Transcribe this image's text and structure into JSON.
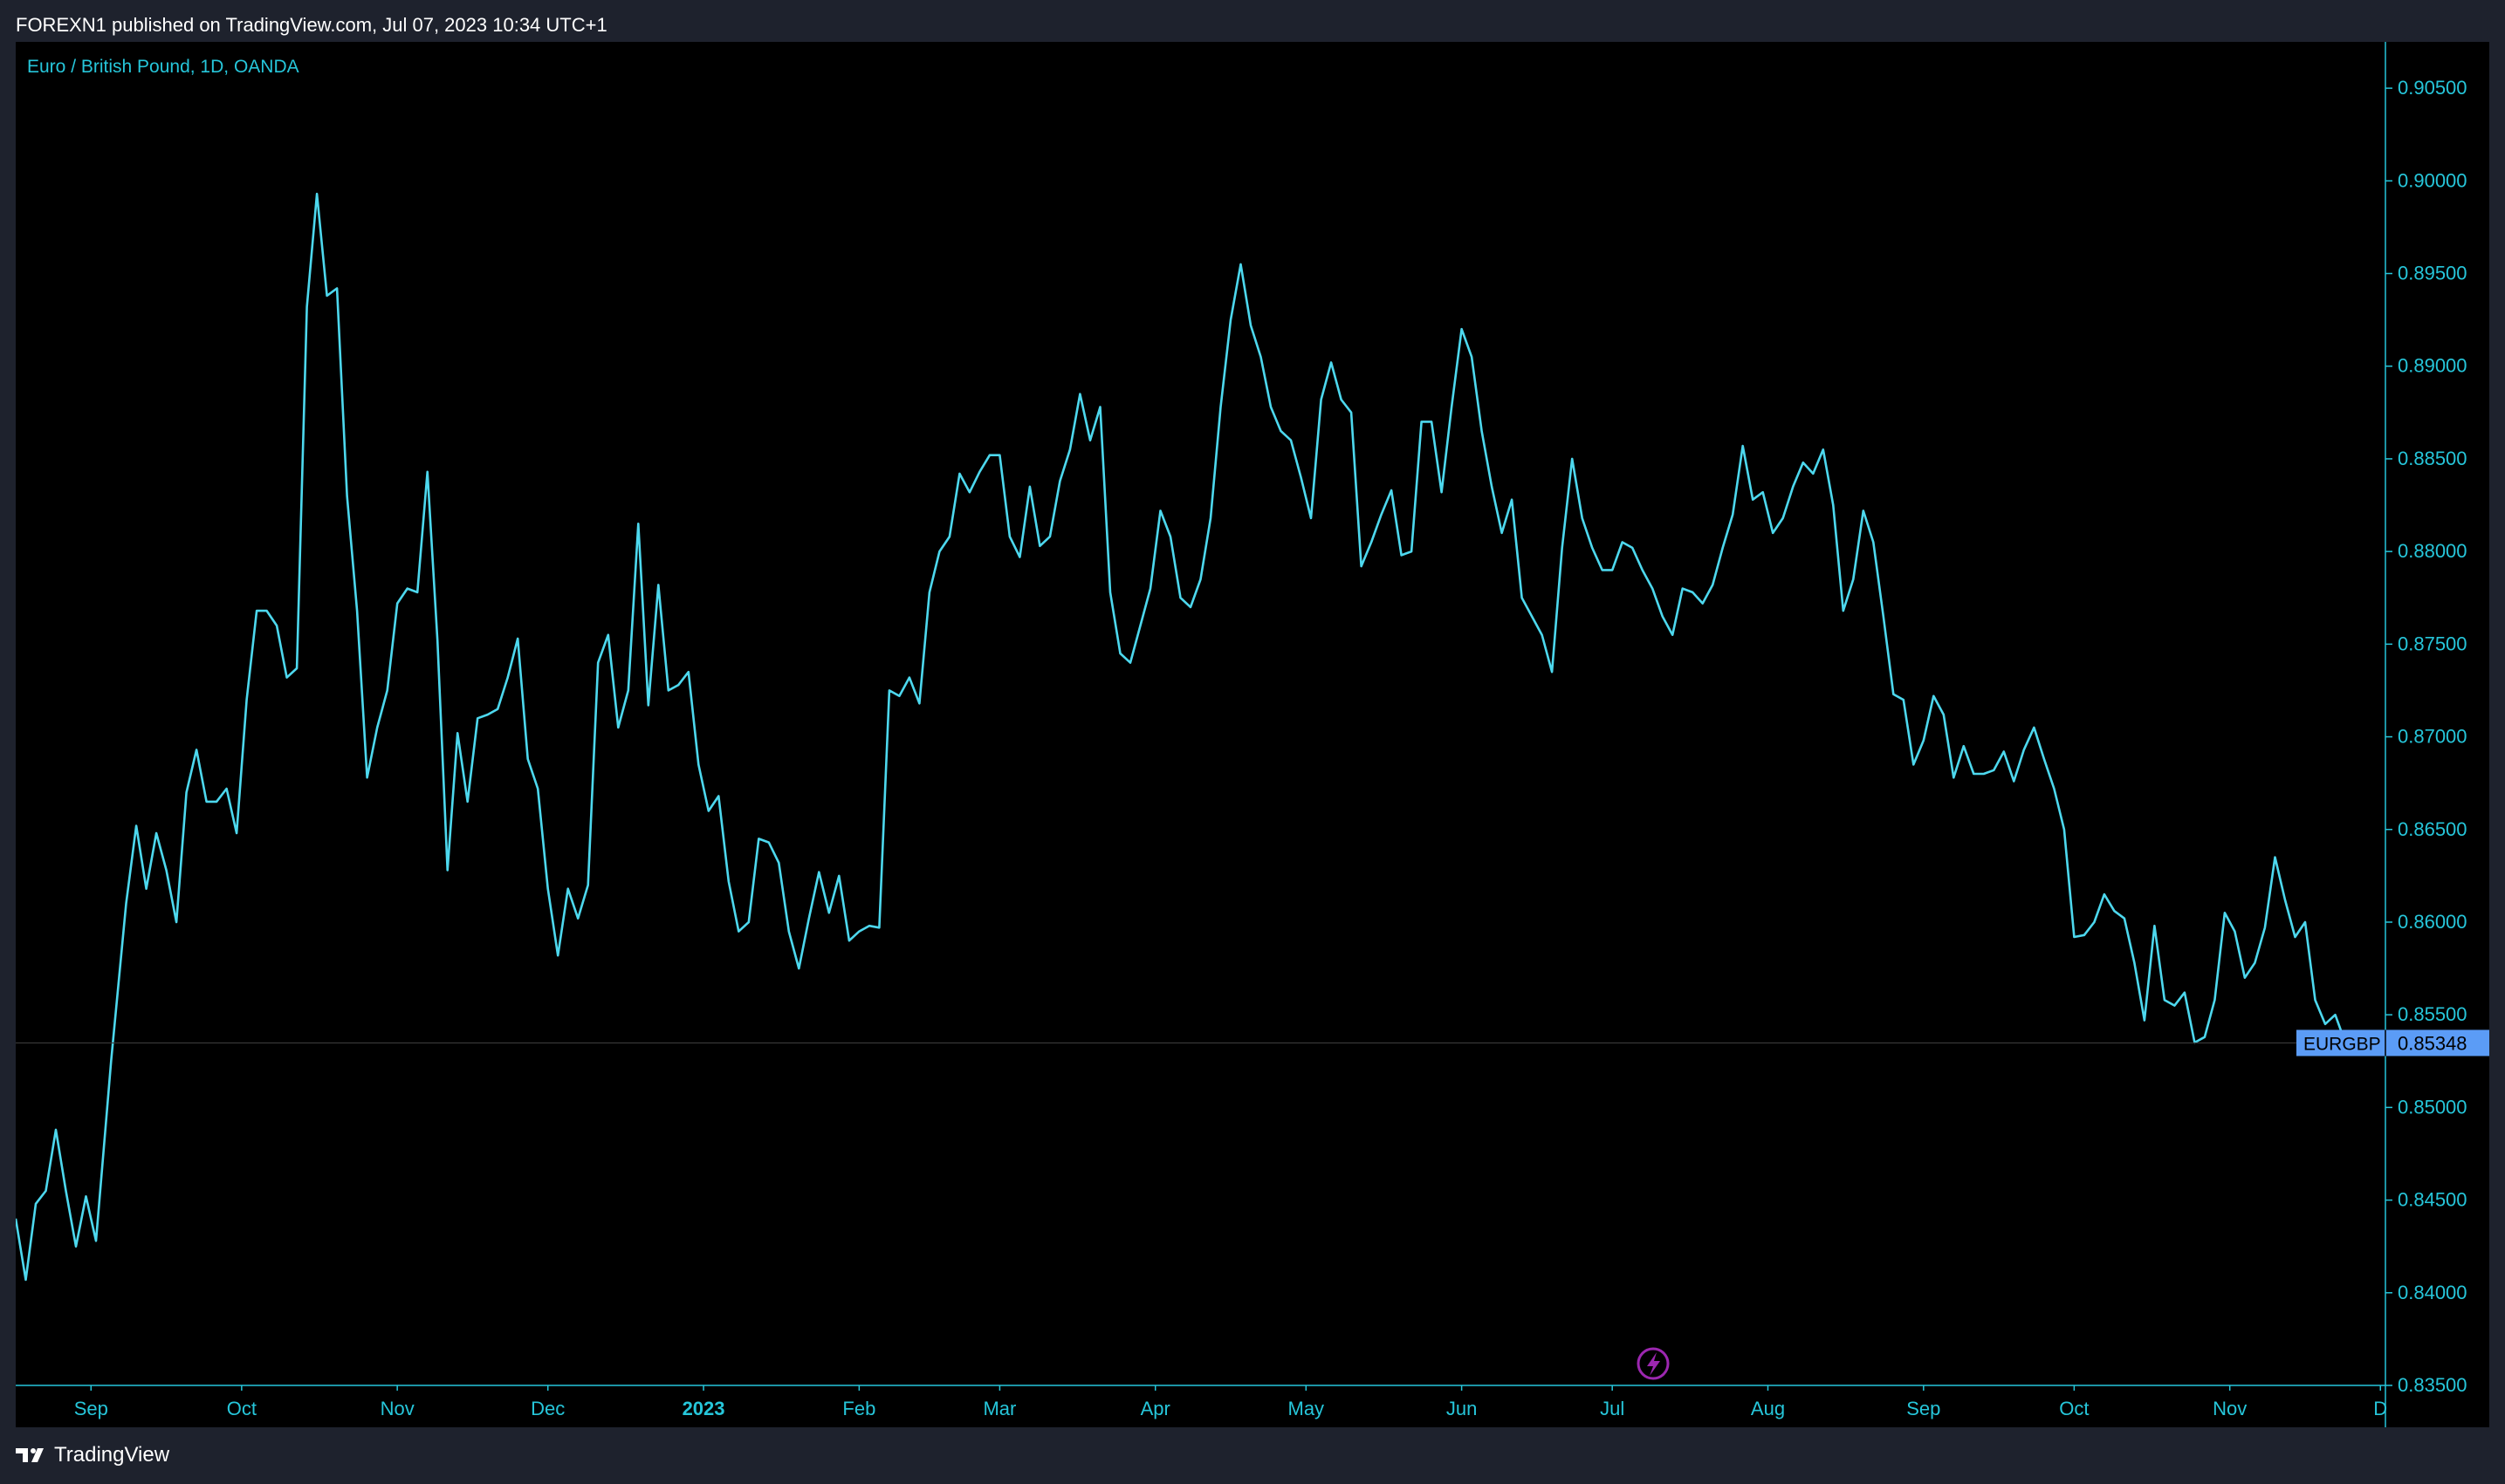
{
  "header": {
    "published_text": "FOREXN1 published on TradingView.com, Jul 07, 2023 10:34 UTC+1"
  },
  "footer": {
    "brand": "TradingView",
    "logo_icon": "tradingview-logo-icon"
  },
  "colors": {
    "line": "#4dd8ee",
    "axis_text": "#26c6da",
    "badge_bg": "#5b9cf6",
    "badge_text": "#000000",
    "lightning_icon": "#9c27b0",
    "panel_bg": "#000000",
    "frame_bg": "#1e222d"
  },
  "chart_data": {
    "type": "line",
    "title": "Euro / British Pound, 1D, OANDA",
    "xlabel": "",
    "ylabel": "",
    "grid": false,
    "ylim": [
      0.835,
      0.9075
    ],
    "xlim": [
      "2022-08-17",
      "2023-12-02"
    ],
    "y_ticks": [
      "0.90500",
      "0.90000",
      "0.89500",
      "0.89000",
      "0.88500",
      "0.88000",
      "0.87500",
      "0.87000",
      "0.86500",
      "0.86000",
      "0.85500",
      "0.85000",
      "0.84500",
      "0.84000",
      "0.83500"
    ],
    "x_ticks": [
      {
        "label": "Sep",
        "date": "2022-09-01",
        "bold": false
      },
      {
        "label": "Oct",
        "date": "2022-10-01",
        "bold": false
      },
      {
        "label": "Nov",
        "date": "2022-11-01",
        "bold": false
      },
      {
        "label": "Dec",
        "date": "2022-12-01",
        "bold": false
      },
      {
        "label": "2023",
        "date": "2023-01-01",
        "bold": true
      },
      {
        "label": "Feb",
        "date": "2023-02-01",
        "bold": false
      },
      {
        "label": "Mar",
        "date": "2023-03-01",
        "bold": false
      },
      {
        "label": "Apr",
        "date": "2023-04-01",
        "bold": false
      },
      {
        "label": "May",
        "date": "2023-05-01",
        "bold": false
      },
      {
        "label": "Jun",
        "date": "2023-06-01",
        "bold": false
      },
      {
        "label": "Jul",
        "date": "2023-07-01",
        "bold": false
      },
      {
        "label": "Aug",
        "date": "2023-08-01",
        "bold": false
      },
      {
        "label": "Sep",
        "date": "2023-09-01",
        "bold": false
      },
      {
        "label": "Oct",
        "date": "2023-10-01",
        "bold": false
      },
      {
        "label": "Nov",
        "date": "2023-11-01",
        "bold": false
      },
      {
        "label": "D",
        "date": "2023-12-01",
        "bold": false
      }
    ],
    "last_price": {
      "symbol": "EURGBP",
      "value": "0.85348"
    },
    "series": [
      {
        "points": [
          [
            "2022-08-17",
            0.844
          ],
          [
            "2022-08-19",
            0.8407
          ],
          [
            "2022-08-21",
            0.8448
          ],
          [
            "2022-08-23",
            0.8455
          ],
          [
            "2022-08-25",
            0.8488
          ],
          [
            "2022-08-27",
            0.8455
          ],
          [
            "2022-08-29",
            0.8425
          ],
          [
            "2022-08-31",
            0.8452
          ],
          [
            "2022-09-02",
            0.8428
          ],
          [
            "2022-09-05",
            0.8525
          ],
          [
            "2022-09-08",
            0.861
          ],
          [
            "2022-09-10",
            0.8652
          ],
          [
            "2022-09-12",
            0.8618
          ],
          [
            "2022-09-14",
            0.8648
          ],
          [
            "2022-09-16",
            0.8628
          ],
          [
            "2022-09-18",
            0.86
          ],
          [
            "2022-09-20",
            0.867
          ],
          [
            "2022-09-22",
            0.8693
          ],
          [
            "2022-09-24",
            0.8665
          ],
          [
            "2022-09-26",
            0.8665
          ],
          [
            "2022-09-28",
            0.8672
          ],
          [
            "2022-09-30",
            0.8648
          ],
          [
            "2022-10-02",
            0.872
          ],
          [
            "2022-10-04",
            0.8768
          ],
          [
            "2022-10-06",
            0.8768
          ],
          [
            "2022-10-08",
            0.876
          ],
          [
            "2022-10-10",
            0.8732
          ],
          [
            "2022-10-12",
            0.8737
          ],
          [
            "2022-10-14",
            0.8932
          ],
          [
            "2022-10-16",
            0.8993
          ],
          [
            "2022-10-18",
            0.8938
          ],
          [
            "2022-10-20",
            0.8942
          ],
          [
            "2022-10-22",
            0.883
          ],
          [
            "2022-10-24",
            0.8768
          ],
          [
            "2022-10-26",
            0.8678
          ],
          [
            "2022-10-28",
            0.8705
          ],
          [
            "2022-10-30",
            0.8725
          ],
          [
            "2022-11-01",
            0.8772
          ],
          [
            "2022-11-03",
            0.878
          ],
          [
            "2022-11-05",
            0.8778
          ],
          [
            "2022-11-07",
            0.8843
          ],
          [
            "2022-11-09",
            0.8752
          ],
          [
            "2022-11-11",
            0.8628
          ],
          [
            "2022-11-13",
            0.8702
          ],
          [
            "2022-11-15",
            0.8665
          ],
          [
            "2022-11-17",
            0.871
          ],
          [
            "2022-11-19",
            0.8712
          ],
          [
            "2022-11-21",
            0.8715
          ],
          [
            "2022-11-23",
            0.8732
          ],
          [
            "2022-11-25",
            0.8753
          ],
          [
            "2022-11-27",
            0.8688
          ],
          [
            "2022-11-29",
            0.8672
          ],
          [
            "2022-12-01",
            0.8618
          ],
          [
            "2022-12-03",
            0.8582
          ],
          [
            "2022-12-05",
            0.8618
          ],
          [
            "2022-12-07",
            0.8602
          ],
          [
            "2022-12-09",
            0.862
          ],
          [
            "2022-12-11",
            0.874
          ],
          [
            "2022-12-13",
            0.8755
          ],
          [
            "2022-12-15",
            0.8705
          ],
          [
            "2022-12-17",
            0.8725
          ],
          [
            "2022-12-19",
            0.8815
          ],
          [
            "2022-12-21",
            0.8717
          ],
          [
            "2022-12-23",
            0.8782
          ],
          [
            "2022-12-25",
            0.8725
          ],
          [
            "2022-12-27",
            0.8728
          ],
          [
            "2022-12-29",
            0.8735
          ],
          [
            "2022-12-31",
            0.8685
          ],
          [
            "2023-01-02",
            0.866
          ],
          [
            "2023-01-04",
            0.8668
          ],
          [
            "2023-01-06",
            0.8622
          ],
          [
            "2023-01-08",
            0.8595
          ],
          [
            "2023-01-10",
            0.86
          ],
          [
            "2023-01-12",
            0.8645
          ],
          [
            "2023-01-14",
            0.8643
          ],
          [
            "2023-01-16",
            0.8632
          ],
          [
            "2023-01-18",
            0.8595
          ],
          [
            "2023-01-20",
            0.8575
          ],
          [
            "2023-01-22",
            0.8602
          ],
          [
            "2023-01-24",
            0.8627
          ],
          [
            "2023-01-26",
            0.8605
          ],
          [
            "2023-01-28",
            0.8625
          ],
          [
            "2023-01-30",
            0.859
          ],
          [
            "2023-02-01",
            0.8595
          ],
          [
            "2023-02-03",
            0.8598
          ],
          [
            "2023-02-05",
            0.8597
          ],
          [
            "2023-02-07",
            0.8725
          ],
          [
            "2023-02-09",
            0.8722
          ],
          [
            "2023-02-11",
            0.8732
          ],
          [
            "2023-02-13",
            0.8718
          ],
          [
            "2023-02-15",
            0.8778
          ],
          [
            "2023-02-17",
            0.88
          ],
          [
            "2023-02-19",
            0.8808
          ],
          [
            "2023-02-21",
            0.8842
          ],
          [
            "2023-02-23",
            0.8832
          ],
          [
            "2023-02-25",
            0.8843
          ],
          [
            "2023-02-27",
            0.8852
          ],
          [
            "2023-03-01",
            0.8852
          ],
          [
            "2023-03-03",
            0.8808
          ],
          [
            "2023-03-05",
            0.8797
          ],
          [
            "2023-03-07",
            0.8835
          ],
          [
            "2023-03-09",
            0.8803
          ],
          [
            "2023-03-11",
            0.8808
          ],
          [
            "2023-03-13",
            0.8838
          ],
          [
            "2023-03-15",
            0.8855
          ],
          [
            "2023-03-17",
            0.8885
          ],
          [
            "2023-03-19",
            0.886
          ],
          [
            "2023-03-21",
            0.8878
          ],
          [
            "2023-03-23",
            0.8778
          ],
          [
            "2023-03-25",
            0.8745
          ],
          [
            "2023-03-27",
            0.874
          ],
          [
            "2023-03-29",
            0.876
          ],
          [
            "2023-03-31",
            0.878
          ],
          [
            "2023-04-02",
            0.8822
          ],
          [
            "2023-04-04",
            0.8808
          ],
          [
            "2023-04-06",
            0.8775
          ],
          [
            "2023-04-08",
            0.877
          ],
          [
            "2023-04-10",
            0.8785
          ],
          [
            "2023-04-12",
            0.8818
          ],
          [
            "2023-04-14",
            0.8878
          ],
          [
            "2023-04-16",
            0.8925
          ],
          [
            "2023-04-18",
            0.8955
          ],
          [
            "2023-04-20",
            0.8922
          ],
          [
            "2023-04-22",
            0.8905
          ],
          [
            "2023-04-24",
            0.8878
          ],
          [
            "2023-04-26",
            0.8865
          ],
          [
            "2023-04-28",
            0.886
          ],
          [
            "2023-04-30",
            0.884
          ],
          [
            "2023-05-02",
            0.8818
          ],
          [
            "2023-05-04",
            0.8882
          ],
          [
            "2023-05-06",
            0.8902
          ],
          [
            "2023-05-08",
            0.8882
          ],
          [
            "2023-05-10",
            0.8875
          ],
          [
            "2023-05-12",
            0.8792
          ],
          [
            "2023-05-14",
            0.8805
          ],
          [
            "2023-05-16",
            0.882
          ],
          [
            "2023-05-18",
            0.8833
          ],
          [
            "2023-05-20",
            0.8798
          ],
          [
            "2023-05-22",
            0.88
          ],
          [
            "2023-05-24",
            0.887
          ],
          [
            "2023-05-26",
            0.887
          ],
          [
            "2023-05-28",
            0.8832
          ],
          [
            "2023-05-30",
            0.8878
          ],
          [
            "2023-06-01",
            0.892
          ],
          [
            "2023-06-03",
            0.8905
          ],
          [
            "2023-06-05",
            0.8865
          ],
          [
            "2023-06-07",
            0.8835
          ],
          [
            "2023-06-09",
            0.881
          ],
          [
            "2023-06-11",
            0.8828
          ],
          [
            "2023-06-13",
            0.8775
          ],
          [
            "2023-06-15",
            0.8765
          ],
          [
            "2023-06-17",
            0.8755
          ],
          [
            "2023-06-19",
            0.8735
          ],
          [
            "2023-06-21",
            0.8802
          ],
          [
            "2023-06-23",
            0.885
          ],
          [
            "2023-06-25",
            0.8818
          ],
          [
            "2023-06-27",
            0.8802
          ],
          [
            "2023-06-29",
            0.879
          ],
          [
            "2023-07-01",
            0.879
          ],
          [
            "2023-07-03",
            0.8805
          ],
          [
            "2023-07-05",
            0.8802
          ],
          [
            "2023-07-07",
            0.879
          ],
          [
            "2023-07-09",
            0.878
          ],
          [
            "2023-07-11",
            0.8765
          ],
          [
            "2023-07-13",
            0.8755
          ],
          [
            "2023-07-15",
            0.878
          ],
          [
            "2023-07-17",
            0.8778
          ],
          [
            "2023-07-19",
            0.8772
          ],
          [
            "2023-07-21",
            0.8782
          ],
          [
            "2023-07-23",
            0.8802
          ],
          [
            "2023-07-25",
            0.882
          ],
          [
            "2023-07-27",
            0.8857
          ],
          [
            "2023-07-29",
            0.8828
          ],
          [
            "2023-07-31",
            0.8832
          ],
          [
            "2023-08-02",
            0.881
          ],
          [
            "2023-08-04",
            0.8818
          ],
          [
            "2023-08-06",
            0.8835
          ],
          [
            "2023-08-08",
            0.8848
          ],
          [
            "2023-08-10",
            0.8842
          ],
          [
            "2023-08-12",
            0.8855
          ],
          [
            "2023-08-14",
            0.8825
          ],
          [
            "2023-08-16",
            0.8768
          ],
          [
            "2023-08-18",
            0.8785
          ],
          [
            "2023-08-20",
            0.8822
          ],
          [
            "2023-08-22",
            0.8805
          ],
          [
            "2023-08-24",
            0.8765
          ],
          [
            "2023-08-26",
            0.8723
          ],
          [
            "2023-08-28",
            0.872
          ],
          [
            "2023-08-30",
            0.8685
          ],
          [
            "2023-09-01",
            0.8698
          ],
          [
            "2023-09-03",
            0.8722
          ],
          [
            "2023-09-05",
            0.8712
          ],
          [
            "2023-09-07",
            0.8678
          ],
          [
            "2023-09-09",
            0.8695
          ],
          [
            "2023-09-11",
            0.868
          ],
          [
            "2023-09-13",
            0.868
          ],
          [
            "2023-09-15",
            0.8682
          ],
          [
            "2023-09-17",
            0.8692
          ],
          [
            "2023-09-19",
            0.8676
          ],
          [
            "2023-09-21",
            0.8693
          ],
          [
            "2023-09-23",
            0.8705
          ],
          [
            "2023-09-25",
            0.8688
          ],
          [
            "2023-09-27",
            0.8672
          ],
          [
            "2023-09-29",
            0.865
          ],
          [
            "2023-10-01",
            0.8592
          ],
          [
            "2023-10-03",
            0.8593
          ],
          [
            "2023-10-05",
            0.86
          ],
          [
            "2023-10-07",
            0.8615
          ],
          [
            "2023-10-09",
            0.8606
          ],
          [
            "2023-10-11",
            0.8602
          ],
          [
            "2023-10-13",
            0.8578
          ],
          [
            "2023-10-15",
            0.8547
          ],
          [
            "2023-10-17",
            0.8598
          ],
          [
            "2023-10-19",
            0.8558
          ],
          [
            "2023-10-21",
            0.8555
          ],
          [
            "2023-10-23",
            0.8562
          ],
          [
            "2023-10-25",
            0.8535
          ],
          [
            "2023-10-27",
            0.8538
          ],
          [
            "2023-10-29",
            0.8558
          ],
          [
            "2023-10-31",
            0.8605
          ],
          [
            "2023-11-02",
            0.8595
          ],
          [
            "2023-11-04",
            0.857
          ],
          [
            "2023-11-06",
            0.8578
          ],
          [
            "2023-11-08",
            0.8597
          ],
          [
            "2023-11-10",
            0.8635
          ],
          [
            "2023-11-12",
            0.8612
          ],
          [
            "2023-11-14",
            0.8592
          ],
          [
            "2023-11-16",
            0.86
          ],
          [
            "2023-11-18",
            0.8558
          ],
          [
            "2023-11-20",
            0.8545
          ],
          [
            "2023-11-22",
            0.855
          ],
          [
            "2023-11-24",
            0.8535
          ]
        ]
      }
    ]
  }
}
